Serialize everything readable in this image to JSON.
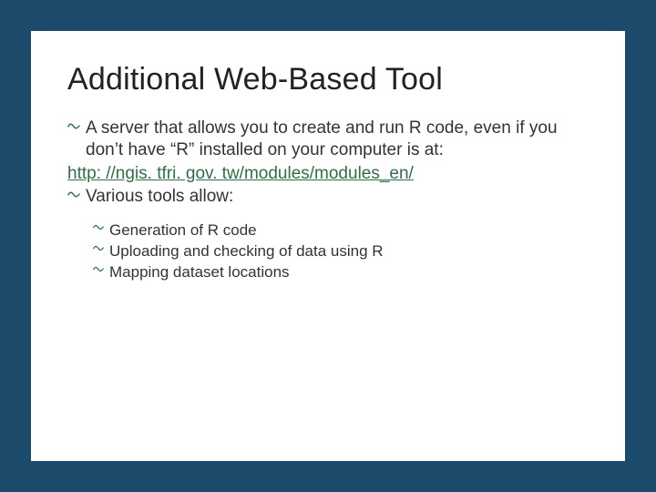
{
  "slide": {
    "title": "Additional Web-Based Tool",
    "bullets": [
      {
        "text": "A server that allows you to create and run R code, even if you don’t have “R” installed on your computer is at:"
      }
    ],
    "link_text": "http: //ngis. tfri. gov. tw/modules/modules_en/",
    "bullets2": [
      {
        "text": "Various tools allow:"
      }
    ],
    "sub_bullets": [
      {
        "text": "Generation of R code"
      },
      {
        "text": "Uploading and checking of data using R"
      },
      {
        "text": "Mapping dataset locations"
      }
    ]
  }
}
